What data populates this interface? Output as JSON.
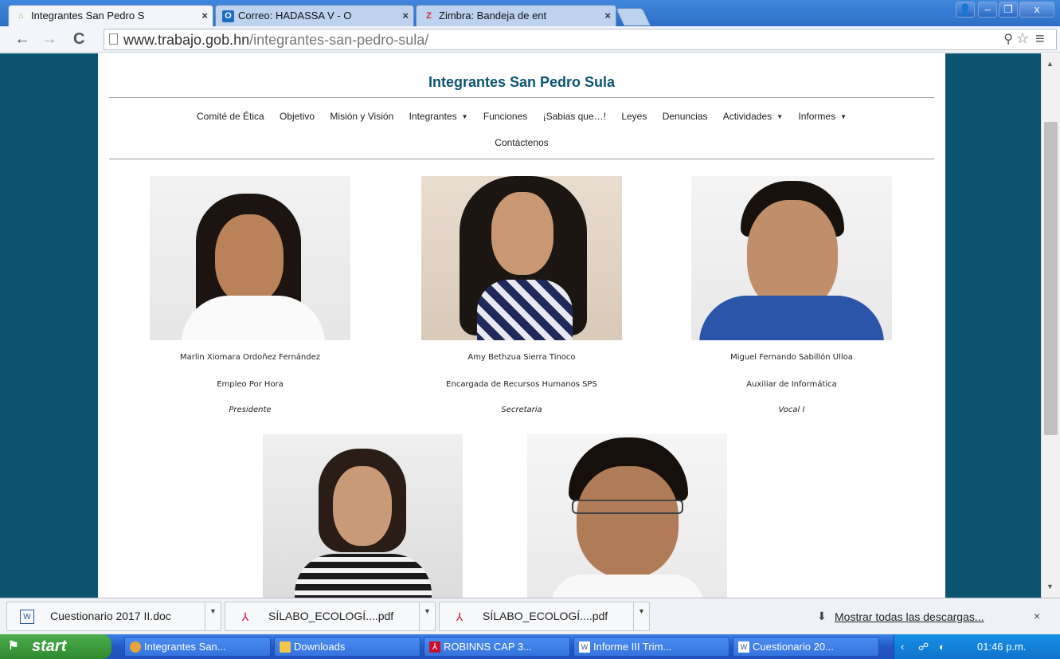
{
  "browser": {
    "tabs": [
      {
        "label": "Integrantes San Pedro S",
        "active": true,
        "icon": "site-favicon"
      },
      {
        "label": "Correo: HADASSA V - O",
        "active": false,
        "icon": "outlook-icon"
      },
      {
        "label": "Zimbra: Bandeja de ent",
        "active": false,
        "icon": "zimbra-icon"
      }
    ],
    "url_host": "www.trabajo.gob.hn",
    "url_path": "/integrantes-san-pedro-sula/"
  },
  "page": {
    "title": "Integrantes San Pedro Sula",
    "menu": [
      {
        "label": "Comité de Ética",
        "dropdown": false
      },
      {
        "label": "Objetivo",
        "dropdown": false
      },
      {
        "label": "Misión y Visión",
        "dropdown": false
      },
      {
        "label": "Integrantes",
        "dropdown": true
      },
      {
        "label": "Funciones",
        "dropdown": false
      },
      {
        "label": "¡Sabias que…!",
        "dropdown": false
      },
      {
        "label": "Leyes",
        "dropdown": false
      },
      {
        "label": "Denuncias",
        "dropdown": false
      },
      {
        "label": "Actividades",
        "dropdown": true
      },
      {
        "label": "Informes",
        "dropdown": true
      }
    ],
    "menu_row2": "Contáctenos",
    "members": [
      {
        "name": "Marlin Xiomara Ordoñez Fernández",
        "job": "Empleo Por Hora",
        "role": "Presidente"
      },
      {
        "name": "Amy Bethzua Sierra Tinoco",
        "job": "Encargada de Recursos Humanos SPS",
        "role": "Secretaria"
      },
      {
        "name": "Miguel Fernando Sabillón Ulloa",
        "job": "Auxiliar de Informática",
        "role": "Vocal I"
      }
    ]
  },
  "downloads": {
    "items": [
      {
        "label": "Cuestionario 2017 II.doc",
        "icon": "word-doc-icon"
      },
      {
        "label": "SÍLABO_ECOLOGÍ....pdf",
        "icon": "pdf-icon"
      },
      {
        "label": "SÍLABO_ECOLOGÍ....pdf",
        "icon": "pdf-icon"
      }
    ],
    "show_all": "Mostrar todas las descargas...",
    "close": "×"
  },
  "taskbar": {
    "start": "start",
    "tasks": [
      {
        "label": "Integrantes San...",
        "icon": "chrome-icon"
      },
      {
        "label": "Downloads",
        "icon": "folder-icon"
      },
      {
        "label": "ROBINNS CAP 3...",
        "icon": "pdf-icon"
      },
      {
        "label": "Informe III Trim...",
        "icon": "word-doc-icon"
      },
      {
        "label": "Cuestionario 20...",
        "icon": "word-doc-icon"
      }
    ],
    "clock": "01:46 p.m."
  },
  "colors": {
    "page_bg": "#0b5470",
    "title": "#0b5470",
    "tab_strip": "#2d6fc6",
    "taskbar": "#2458c7",
    "start": "#2f8a2f"
  }
}
